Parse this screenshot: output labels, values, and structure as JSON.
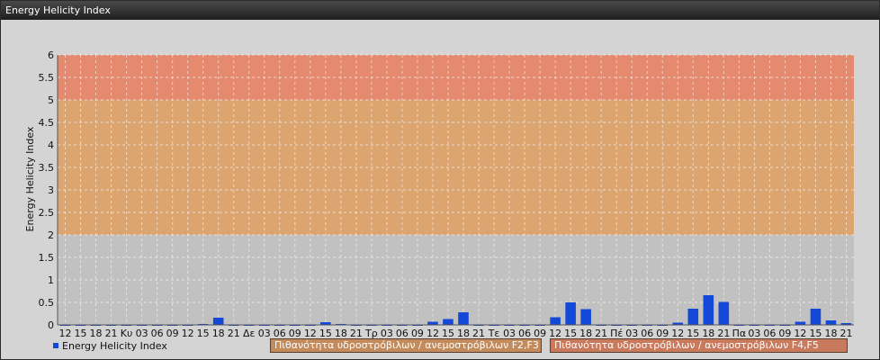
{
  "window": {
    "title": "Energy Helicity Index"
  },
  "chart_data": {
    "type": "bar",
    "title": "",
    "xlabel": "",
    "ylabel": "Energy Helicity Index",
    "ylim": [
      0,
      6
    ],
    "yticks": [
      "0",
      "0.5",
      "1",
      "1.5",
      "2",
      "2.5",
      "3",
      "3.5",
      "4",
      "4.5",
      "5",
      "5.5",
      "6"
    ],
    "grid": true,
    "legend_position": "bottom-left",
    "categories": [
      "12",
      "15",
      "18",
      "21",
      "Κυ",
      "03",
      "06",
      "09",
      "12",
      "15",
      "18",
      "21",
      "Δε",
      "03",
      "06",
      "09",
      "12",
      "15",
      "18",
      "21",
      "Τρ",
      "03",
      "06",
      "09",
      "12",
      "15",
      "18",
      "21",
      "Τε",
      "03",
      "06",
      "09",
      "12",
      "15",
      "18",
      "21",
      "Πέ",
      "03",
      "06",
      "09",
      "12",
      "15",
      "18",
      "21",
      "Πα",
      "03",
      "06",
      "09",
      "12",
      "15",
      "18",
      "21"
    ],
    "series": [
      {
        "name": "Energy Helicity Index",
        "color": "#1448d8",
        "values": [
          0.01,
          0.01,
          0.01,
          0.01,
          0.01,
          0.01,
          0.01,
          0.01,
          0.01,
          0.02,
          0.16,
          0.01,
          0.01,
          0.01,
          0.01,
          0.01,
          0.01,
          0.06,
          0.02,
          0.01,
          0.01,
          0.01,
          0.01,
          0.01,
          0.07,
          0.13,
          0.28,
          0.01,
          0.01,
          0.01,
          0.01,
          0.01,
          0.17,
          0.5,
          0.35,
          0.01,
          0.01,
          0.01,
          0.01,
          0.01,
          0.05,
          0.36,
          0.66,
          0.51,
          0.01,
          0.01,
          0.01,
          0.01,
          0.07,
          0.36,
          0.1,
          0.04
        ]
      }
    ],
    "bands": [
      {
        "from": 0,
        "to": 2,
        "color": "#bcbcbc"
      },
      {
        "from": 2,
        "to": 5,
        "color": "#e0a060",
        "label": "Πιθανότητα υδροστρόβιλων / ανεμοστρόβιλων F2,F3"
      },
      {
        "from": 5,
        "to": 6,
        "color": "#ec8060",
        "label": "Πιθανότητα υδροστρόβιλων / ανεμοστρόβιλων F4,F5"
      }
    ]
  }
}
